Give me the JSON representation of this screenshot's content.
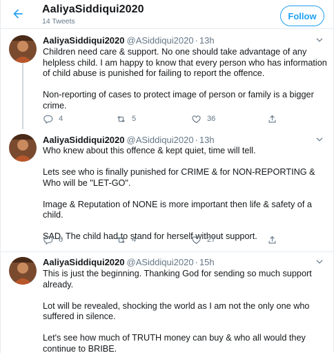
{
  "header": {
    "title": "AaliyaSiddiqui2020",
    "subtitle": "14 Tweets",
    "follow_label": "Follow"
  },
  "colors": {
    "accent": "#1da1f2",
    "muted": "#657786",
    "text": "#14171a",
    "border": "#e6ecf0"
  },
  "tweets": [
    {
      "name": "AaliyaSiddiqui2020",
      "handle": "@ASiddiqui2020",
      "time": "13h",
      "paragraphs": [
        "Children need care & support. No one should take advantage of any helpless child. I am happy to know that every person who has information of child abuse is punished for failing to report the offence.",
        "Non-reporting of cases to protect image of person or family is a bigger crime."
      ],
      "replies": "4",
      "retweets": "5",
      "likes": "36"
    },
    {
      "name": "AaliyaSiddiqui2020",
      "handle": "@ASiddiqui2020",
      "time": "13h",
      "paragraphs": [
        "Who knew about this offence & kept quiet, time will tell.",
        "Lets see who is finally punished for CRIME & for NON-REPORTING & Who will be \"LET-GO\".",
        "Image & Reputation of NONE is more important then life & safety of a child.",
        "SAD. The child had to stand for herself without support."
      ],
      "replies": "6",
      "retweets": "4",
      "likes": "27"
    },
    {
      "name": "AaliyaSiddiqui2020",
      "handle": "@ASiddiqui2020",
      "time": "15h",
      "paragraphs": [
        "This is just the beginning. Thanking God for sending so much support already.",
        "Lot will be revealed, shocking the world as I am not the only one who suffered in silence.",
        "Let's see how much of TRUTH money can buy & who all would they continue to BRIBE."
      ]
    }
  ]
}
